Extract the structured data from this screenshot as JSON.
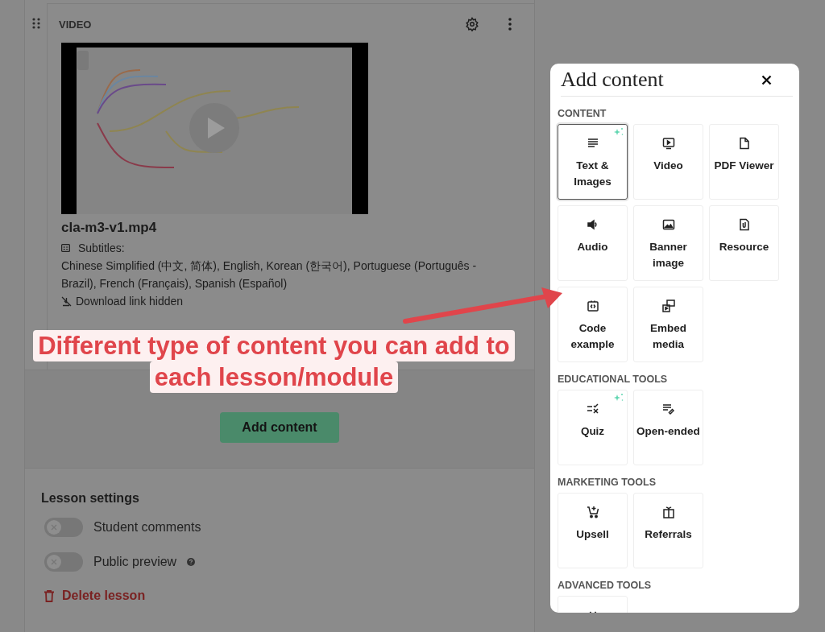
{
  "video_block": {
    "label": "VIDEO",
    "file_name": "cla-m3-v1.mp4",
    "subtitles_label": "Subtitles:",
    "subtitles": "Chinese Simplified (中文, 简体), English, Korean (한국어), Portuguese (Português - Brazil), French (Français), Spanish (Español)",
    "download_note": "Download link hidden"
  },
  "add_content_button": "Add content",
  "lesson_settings": {
    "title": "Lesson settings",
    "toggles": [
      {
        "label": "Student comments",
        "on": false,
        "help": false
      },
      {
        "label": "Public preview",
        "on": false,
        "help": true
      }
    ],
    "delete_label": "Delete lesson"
  },
  "annotation": {
    "lines": [
      "Different type of content you can add to",
      "each lesson/module"
    ]
  },
  "modal": {
    "title": "Add content",
    "sections": [
      {
        "title": "CONTENT",
        "items": [
          {
            "label": "Text & Images",
            "selected": true,
            "sparkle": true
          },
          {
            "label": "Video",
            "selected": false,
            "sparkle": false
          },
          {
            "label": "PDF Viewer",
            "selected": false,
            "sparkle": false
          },
          {
            "label": "Audio",
            "selected": false,
            "sparkle": false
          },
          {
            "label": "Banner image",
            "selected": false,
            "sparkle": false
          },
          {
            "label": "Resource",
            "selected": false,
            "sparkle": false
          },
          {
            "label": "Code example",
            "selected": false,
            "sparkle": false
          },
          {
            "label": "Embed media",
            "selected": false,
            "sparkle": false
          }
        ]
      },
      {
        "title": "EDUCATIONAL TOOLS",
        "items": [
          {
            "label": "Quiz",
            "selected": false,
            "sparkle": true
          },
          {
            "label": "Open-ended",
            "selected": false,
            "sparkle": false
          }
        ]
      },
      {
        "title": "MARKETING TOOLS",
        "items": [
          {
            "label": "Upsell",
            "selected": false,
            "sparkle": false
          },
          {
            "label": "Referrals",
            "selected": false,
            "sparkle": false
          }
        ]
      },
      {
        "title": "ADVANCED TOOLS",
        "items": [
          {
            "selected": false,
            "sparkle": false
          }
        ]
      }
    ]
  }
}
